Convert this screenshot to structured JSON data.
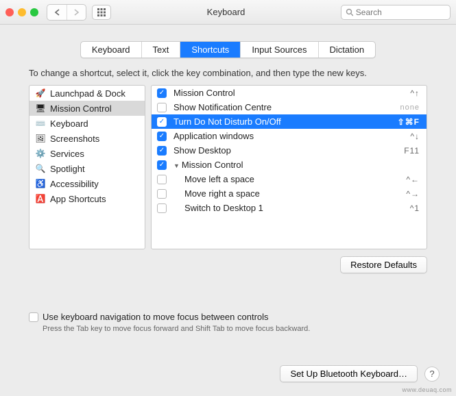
{
  "window": {
    "title": "Keyboard",
    "search_placeholder": "Search"
  },
  "tabs": [
    "Keyboard",
    "Text",
    "Shortcuts",
    "Input Sources",
    "Dictation"
  ],
  "active_tab": "Shortcuts",
  "hint": "To change a shortcut, select it, click the key combination, and then type the new keys.",
  "categories": [
    {
      "icon": "🚀",
      "label": "Launchpad & Dock"
    },
    {
      "icon": "🖥",
      "label": "Mission Control",
      "selected": true
    },
    {
      "icon": "⌨️",
      "label": "Keyboard"
    },
    {
      "icon": "🖼",
      "label": "Screenshots"
    },
    {
      "icon": "⚙️",
      "label": "Services"
    },
    {
      "icon": "🔍",
      "label": "Spotlight"
    },
    {
      "icon": "♿️",
      "label": "Accessibility"
    },
    {
      "icon": "🅰️",
      "label": "App Shortcuts"
    }
  ],
  "shortcuts": [
    {
      "checked": true,
      "label": "Mission Control",
      "key": "^↑",
      "indent": 0
    },
    {
      "checked": false,
      "label": "Show Notification Centre",
      "key": "none",
      "indent": 0
    },
    {
      "checked": true,
      "label": "Turn Do Not Disturb On/Off",
      "key": "⇧⌘F",
      "indent": 0,
      "selected": true
    },
    {
      "checked": true,
      "label": "Application windows",
      "key": "^↓",
      "indent": 0
    },
    {
      "checked": true,
      "label": "Show Desktop",
      "key": "F11",
      "indent": 0
    },
    {
      "checked": true,
      "label": "Mission Control",
      "key": "",
      "indent": 1,
      "group": true
    },
    {
      "checked": false,
      "label": "Move left a space",
      "key": "^←",
      "indent": 2
    },
    {
      "checked": false,
      "label": "Move right a space",
      "key": "^→",
      "indent": 2
    },
    {
      "checked": false,
      "label": "Switch to Desktop 1",
      "key": "^1",
      "indent": 2
    }
  ],
  "restore_label": "Restore Defaults",
  "kb_nav": {
    "label": "Use keyboard navigation to move focus between controls",
    "sub": "Press the Tab key to move focus forward and Shift Tab to move focus backward."
  },
  "bluetooth_label": "Set Up Bluetooth Keyboard…",
  "watermark": "www.deuaq.com"
}
